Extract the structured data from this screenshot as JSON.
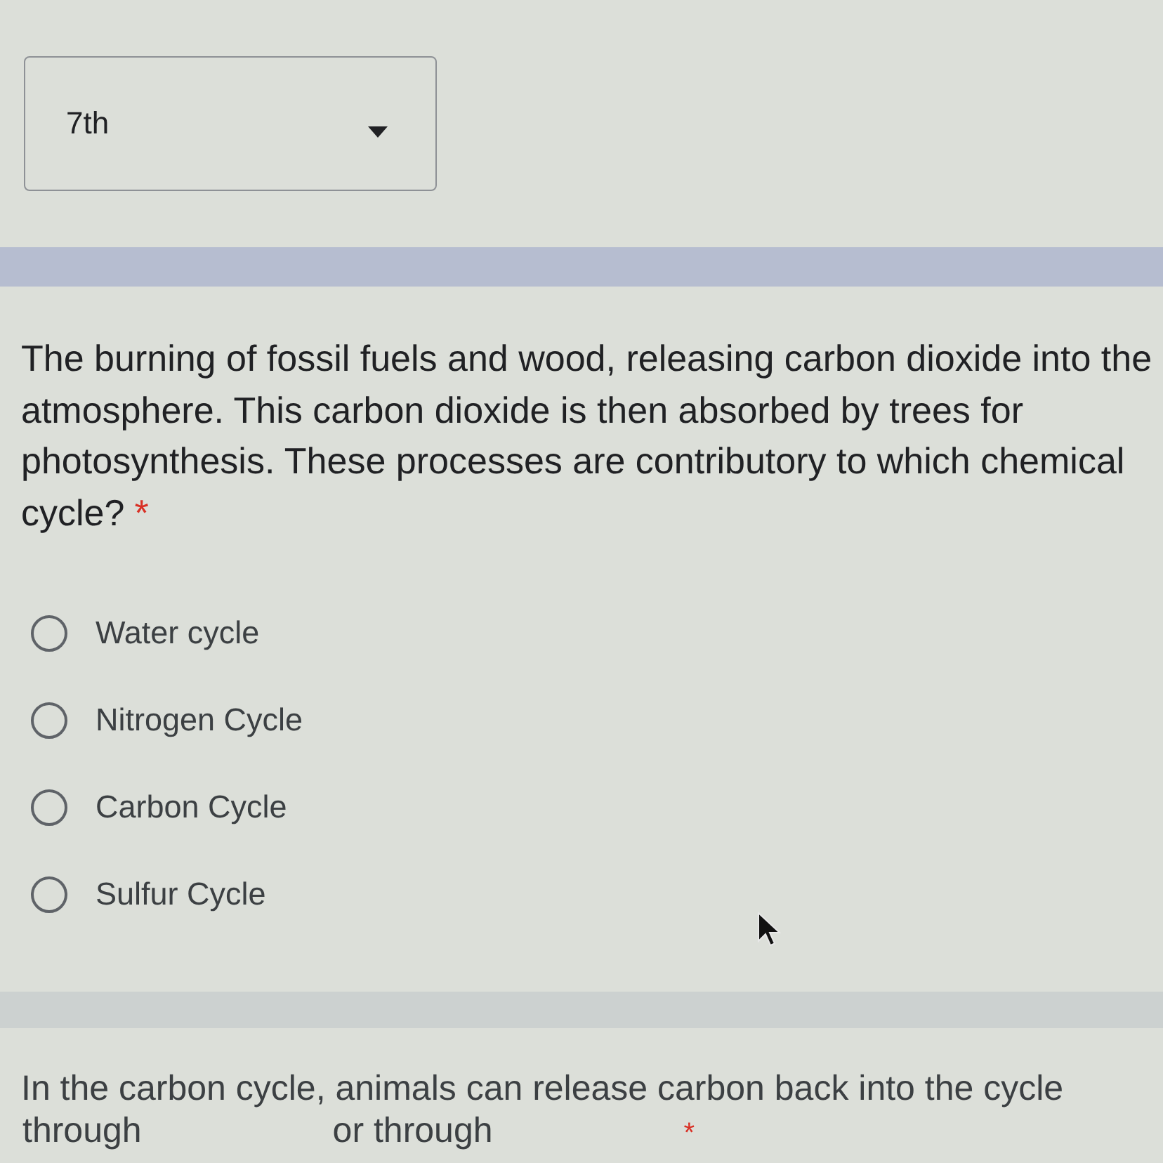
{
  "grade_select": {
    "value": "7th"
  },
  "questions": [
    {
      "kind": "multiple_choice",
      "text": "The burning of fossil fuels and wood, releasing carbon dioxide into the atmosphere. This carbon dioxide is then absorbed by trees for photosynthesis. These processes are contributory to which chemical cycle?",
      "required_mark": "*",
      "options": [
        {
          "label": "Water cycle",
          "selected": false
        },
        {
          "label": "Nitrogen Cycle",
          "selected": false
        },
        {
          "label": "Carbon Cycle",
          "selected": false
        },
        {
          "label": "Sulfur Cycle",
          "selected": false
        }
      ]
    },
    {
      "kind": "fill_in_blanks",
      "text": "In the carbon cycle, animals can release carbon back into the cycle",
      "continuation": [
        "through",
        "or through"
      ],
      "required_mark": "*"
    }
  ]
}
